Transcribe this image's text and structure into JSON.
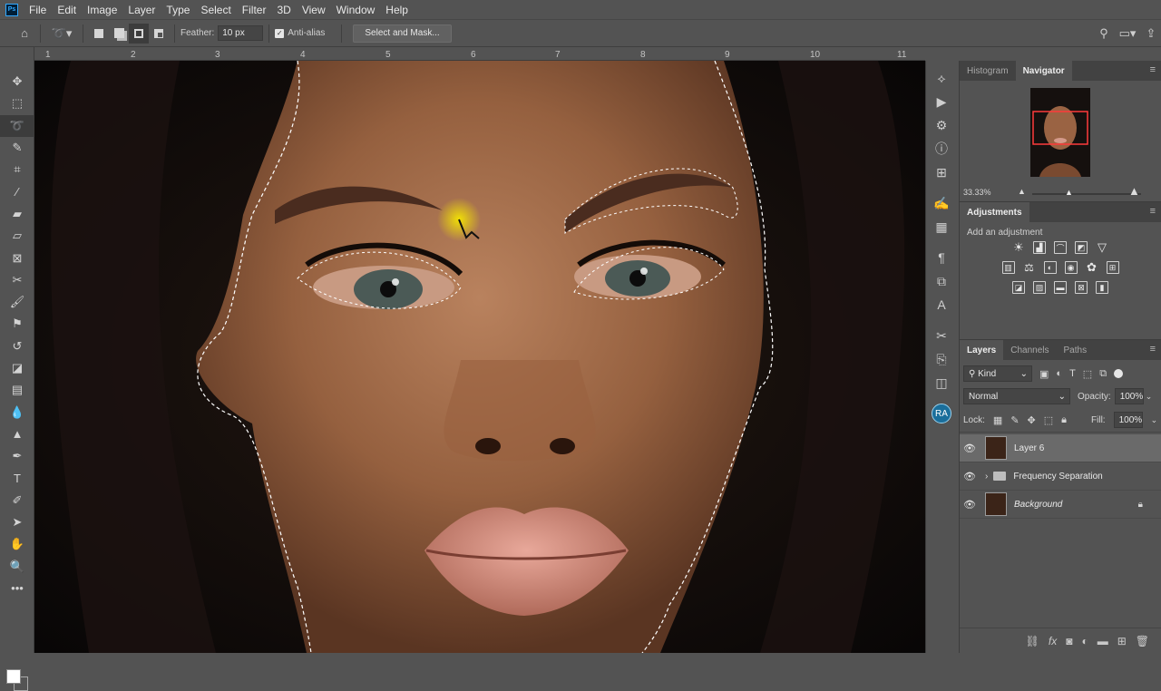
{
  "app": {
    "logo": "Ps"
  },
  "menu": [
    "File",
    "Edit",
    "Image",
    "Layer",
    "Type",
    "Select",
    "Filter",
    "3D",
    "View",
    "Window",
    "Help"
  ],
  "options": {
    "feather_label": "Feather:",
    "feather_value": "10 px",
    "antialias_label": "Anti-alias",
    "select_mask_label": "Select and Mask..."
  },
  "ruler": {
    "ticks": [
      "1",
      "2",
      "3",
      "4",
      "5",
      "6",
      "7",
      "8",
      "9",
      "10",
      "11"
    ]
  },
  "navigator": {
    "tabs": [
      "Histogram",
      "Navigator"
    ],
    "zoom": "33.33%"
  },
  "adjustments": {
    "tab": "Adjustments",
    "prompt": "Add an adjustment"
  },
  "layers": {
    "tabs": [
      "Layers",
      "Channels",
      "Paths"
    ],
    "filter_kind": "Kind",
    "blend_mode": "Normal",
    "opacity_label": "Opacity:",
    "opacity_value": "100%",
    "lock_label": "Lock:",
    "fill_label": "Fill:",
    "fill_value": "100%",
    "items": [
      {
        "name": "Layer 6"
      },
      {
        "name": "Frequency Separation"
      },
      {
        "name": "Background"
      }
    ]
  },
  "user": {
    "initials": "RA"
  },
  "colors": {
    "accent_nav_box": "#ff3b3b",
    "cursor_highlight": "#f5e600"
  }
}
